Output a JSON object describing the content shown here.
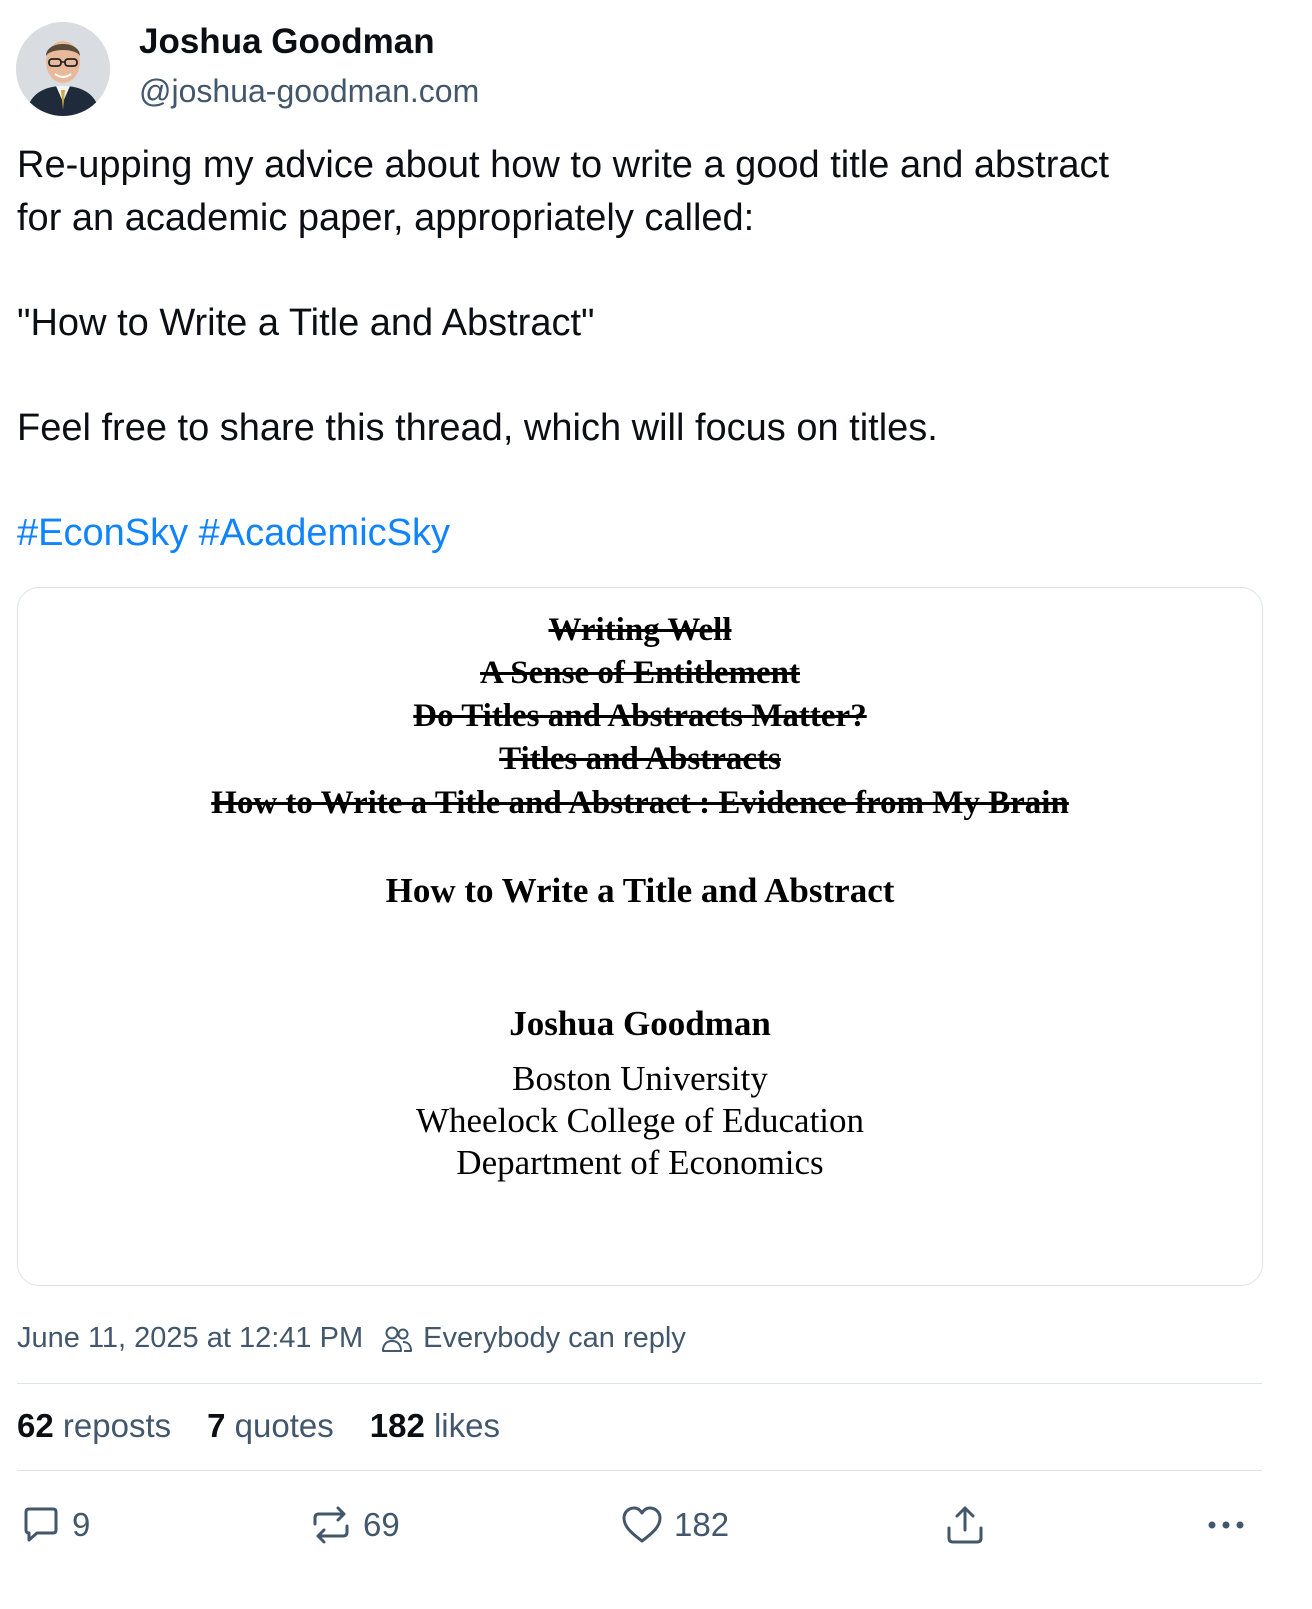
{
  "author": {
    "display_name": "Joshua Goodman",
    "handle": "@joshua-goodman.com"
  },
  "post": {
    "line1": "Re-upping my advice about how to write a good title and abstract",
    "line2": "for an academic paper, appropriately called:",
    "line3": "\"How to Write a Title and Abstract\"",
    "line4": "Feel free to share this thread, which will focus on titles.",
    "hashtags": [
      "#EconSky",
      "#AcademicSky"
    ]
  },
  "image": {
    "struck_titles": [
      "Writing Well",
      "A Sense of Entitlement",
      "Do Titles and Abstracts Matter?",
      "Titles and Abstracts",
      "How to Write a Title and Abstract : Evidence from My Brain"
    ],
    "title": "How to Write a Title and Abstract",
    "author": "Joshua Goodman",
    "affiliations": [
      "Boston University",
      "Wheelock College of Education",
      "Department of Economics"
    ]
  },
  "meta": {
    "timestamp": "June 11, 2025 at 12:41 PM",
    "reply_setting": "Everybody can reply"
  },
  "stats": {
    "reposts_count": "62",
    "reposts_label": "reposts",
    "quotes_count": "7",
    "quotes_label": "quotes",
    "likes_count": "182",
    "likes_label": "likes"
  },
  "actions": {
    "reply_count": "9",
    "repost_count": "69",
    "like_count": "182"
  },
  "colors": {
    "text": "#0b0f14",
    "muted": "#42576c",
    "link": "#1083fe",
    "border": "#dde3ea"
  }
}
